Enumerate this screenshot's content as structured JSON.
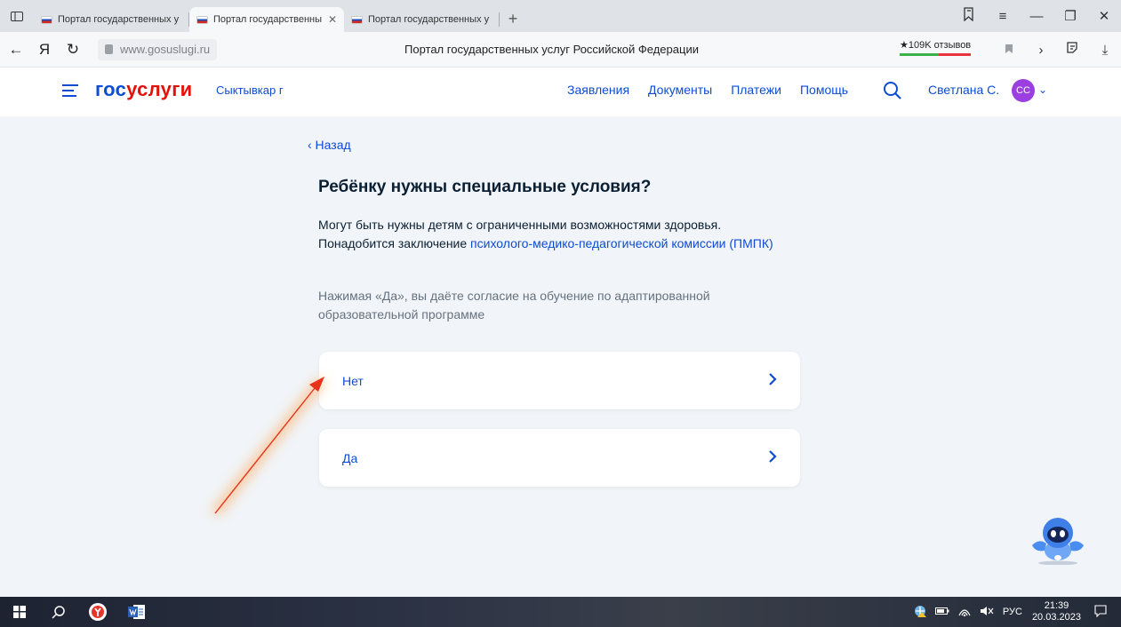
{
  "browser": {
    "tabs": [
      {
        "title": "Портал государственных у",
        "active": false
      },
      {
        "title": "Портал государственны",
        "active": true
      },
      {
        "title": "Портал государственных у",
        "active": false
      }
    ],
    "new_tab_label": "+",
    "url": "www.gosuslugi.ru",
    "page_title": "Портал государственных услуг Российской Федерации",
    "reviews": "★109K отзывов",
    "yandex_letter": "Я"
  },
  "header": {
    "logo_part1": "гос",
    "logo_part2": "услуги",
    "city": "Сыктывкар г",
    "nav": [
      "Заявления",
      "Документы",
      "Платежи",
      "Помощь"
    ],
    "username": "Светлана С.",
    "avatar_initials": "СС"
  },
  "content": {
    "back_label": "‹ Назад",
    "question": "Ребёнку нужны специальные условия?",
    "desc_text": "Могут быть нужны детям с ограниченными возможностями здоровья. Понадобится заключение ",
    "desc_link": "психолого-медико-педагогической комиссии (ПМПК)",
    "consent": "Нажимая «Да», вы даёте согласие на обучение по адаптированной образовательной программе",
    "options": [
      {
        "label": "Нет"
      },
      {
        "label": "Да"
      }
    ]
  },
  "taskbar": {
    "language": "РУС",
    "time": "21:39",
    "date": "20.03.2023"
  },
  "colors": {
    "accent": "#0d4cd3",
    "logo_red": "#e3120b",
    "avatar": "#9b3fe0",
    "arrow": "#e8321a"
  }
}
